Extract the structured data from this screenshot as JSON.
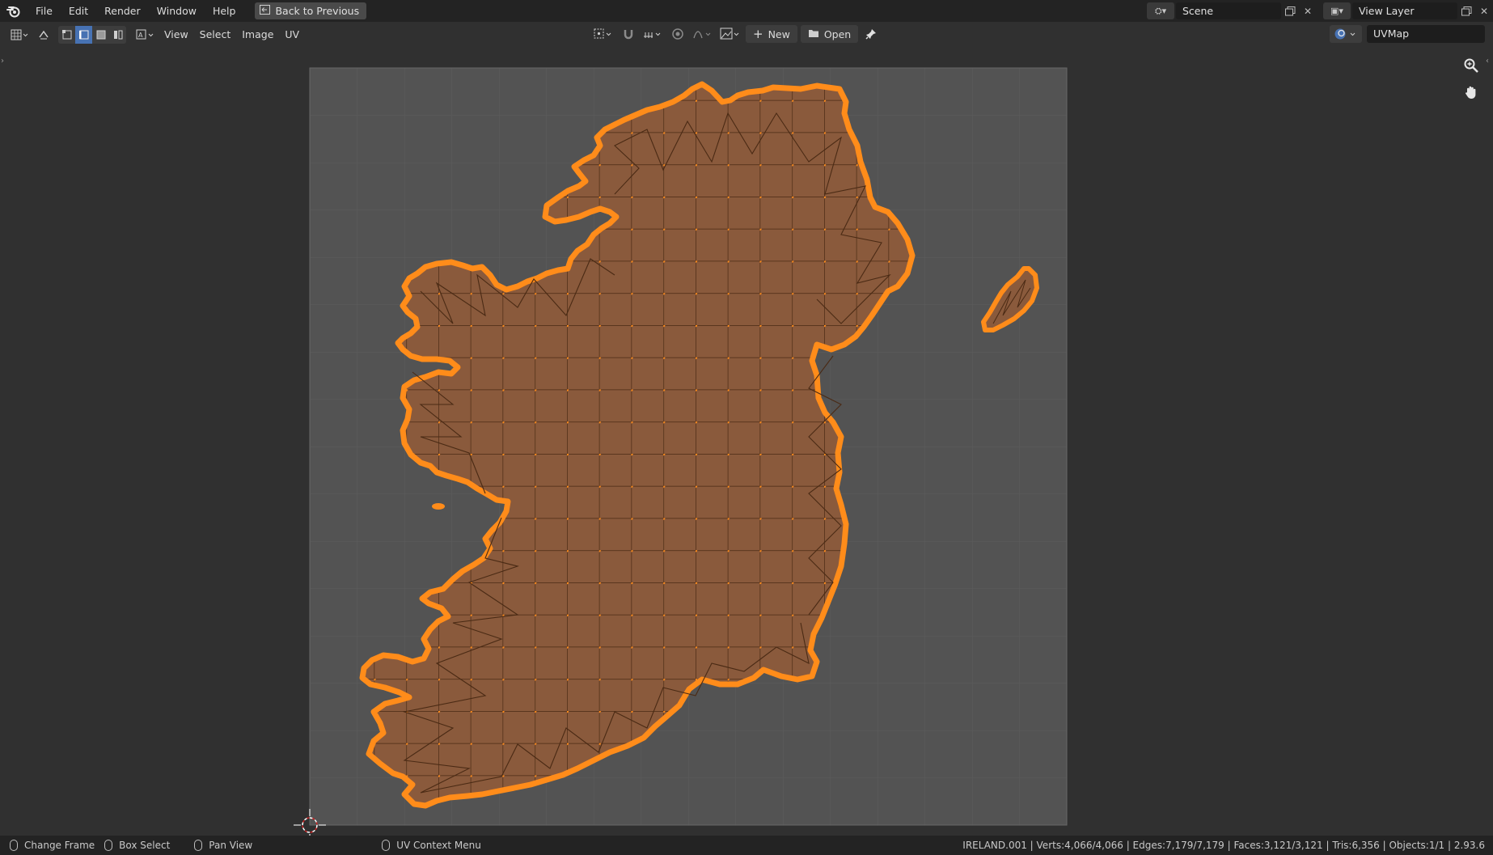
{
  "topbar": {
    "menus": [
      "File",
      "Edit",
      "Render",
      "Window",
      "Help"
    ],
    "back_label": "Back to Previous",
    "scene_value": "Scene",
    "view_layer_value": "View Layer"
  },
  "header": {
    "menus": [
      "View",
      "Select",
      "Image",
      "UV"
    ],
    "new_label": "New",
    "open_label": "Open",
    "uvmap_value": "UVMap"
  },
  "status": {
    "change_frame": "Change Frame",
    "box_select": "Box Select",
    "pan_view": "Pan View",
    "uv_context_menu": "UV Context Menu",
    "stats": "IRELAND.001 | Verts:4,066/4,066 | Edges:7,179/7,179 | Faces:3,121/3,121 | Tris:6,356 | Objects:1/1 | 2.93.6"
  },
  "colors": {
    "selection": "#ff8c1a",
    "face_fill": "#8a5a3c",
    "grid_bg": "#535353",
    "outside_bg": "#303030"
  },
  "icons": [
    "blender-logo-icon",
    "editor-type-icon",
    "scene-icon",
    "new-scene-icon",
    "view-layer-icon",
    "zoom-icon",
    "hand-pan-icon",
    "pin-icon",
    "cursor-2d-icon"
  ]
}
